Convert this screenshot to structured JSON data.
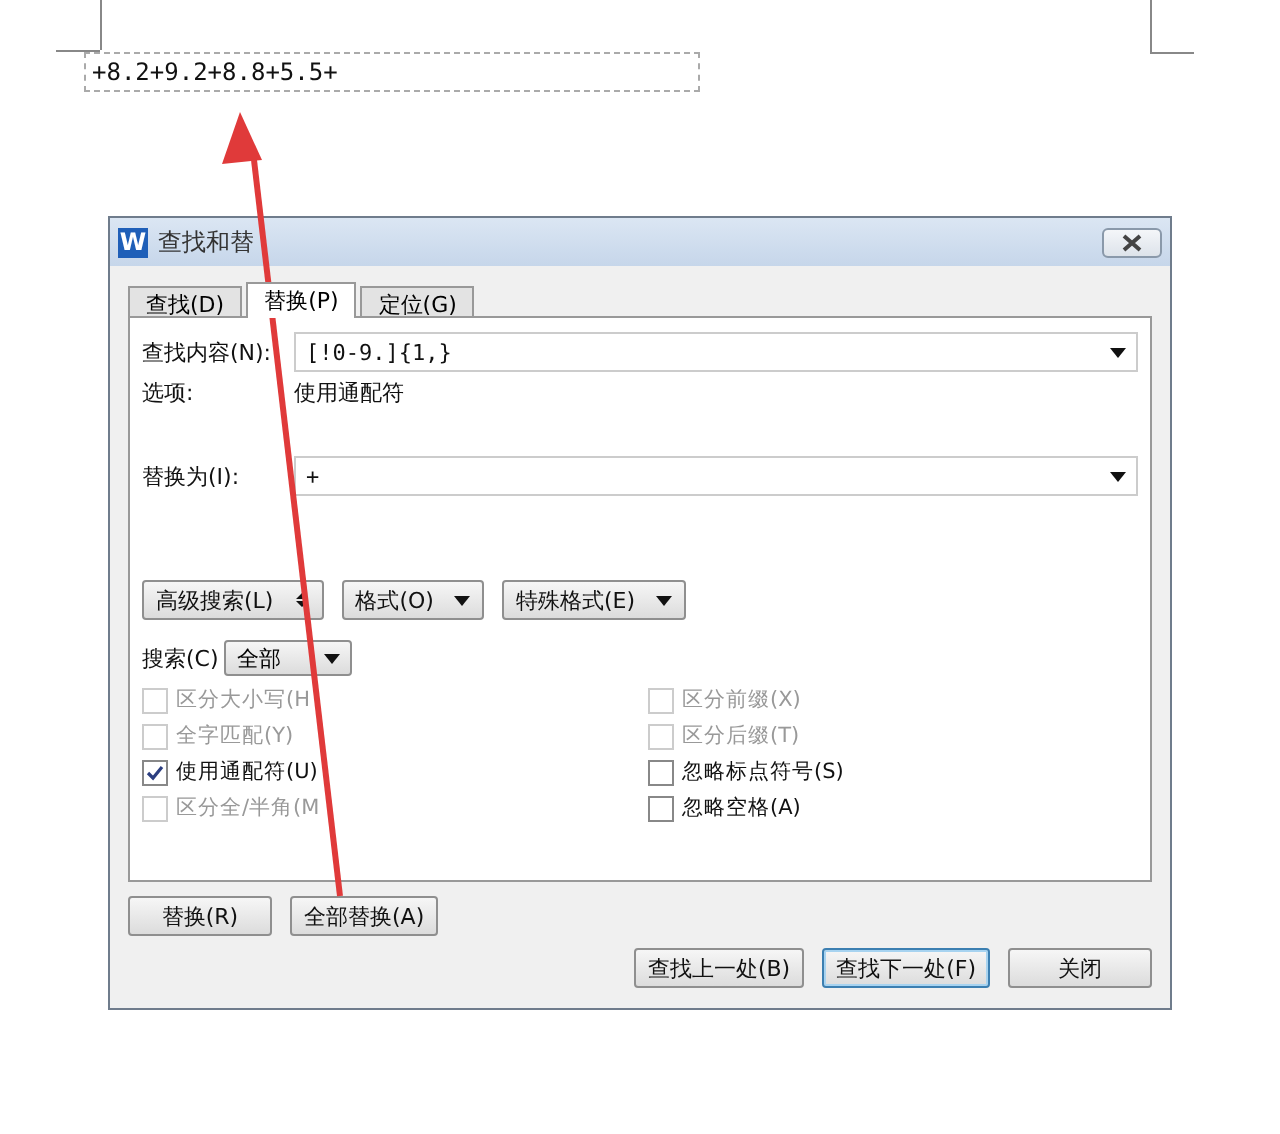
{
  "document": {
    "text": "+8.2+9.2+8.8+5.5+"
  },
  "dialog": {
    "icon_letter": "W",
    "title": "查找和替",
    "tabs": [
      {
        "label": "查找(D)",
        "selected": false
      },
      {
        "label": "替换(P)",
        "selected": true
      },
      {
        "label": "定位(G)",
        "selected": false
      }
    ],
    "find": {
      "label": "查找内容(N):",
      "value": "[!0-9.]{1,}"
    },
    "options": {
      "label": "选项:",
      "value": "使用通配符"
    },
    "replace": {
      "label": "替换为(I):",
      "value": "+"
    },
    "option_buttons": [
      {
        "label": "高级搜索(L)",
        "kind": "expand"
      },
      {
        "label": "格式(O)",
        "kind": "menu"
      },
      {
        "label": "特殊格式(E)",
        "kind": "menu"
      }
    ],
    "search": {
      "label": "搜索(C)",
      "value": "全部"
    },
    "checkboxes_left": [
      {
        "label": "区分大小写(H",
        "checked": false,
        "disabled": true
      },
      {
        "label": "全字匹配(Y)",
        "checked": false,
        "disabled": true
      },
      {
        "label": "使用通配符(U)",
        "checked": true,
        "disabled": false
      },
      {
        "label": "区分全/半角(M",
        "checked": false,
        "disabled": true
      }
    ],
    "checkboxes_right": [
      {
        "label": "区分前缀(X)",
        "checked": false,
        "disabled": true
      },
      {
        "label": "区分后缀(T)",
        "checked": false,
        "disabled": true
      },
      {
        "label": "忽略标点符号(S)",
        "checked": false,
        "disabled": false
      },
      {
        "label": "忽略空格(A)",
        "checked": false,
        "disabled": false
      }
    ],
    "replace_buttons": [
      "替换(R)",
      "全部替换(A)"
    ],
    "nav_buttons": [
      {
        "label": "查找上一处(B)",
        "default": false
      },
      {
        "label": "查找下一处(F)",
        "default": true
      },
      {
        "label": "关闭",
        "default": false
      }
    ]
  }
}
